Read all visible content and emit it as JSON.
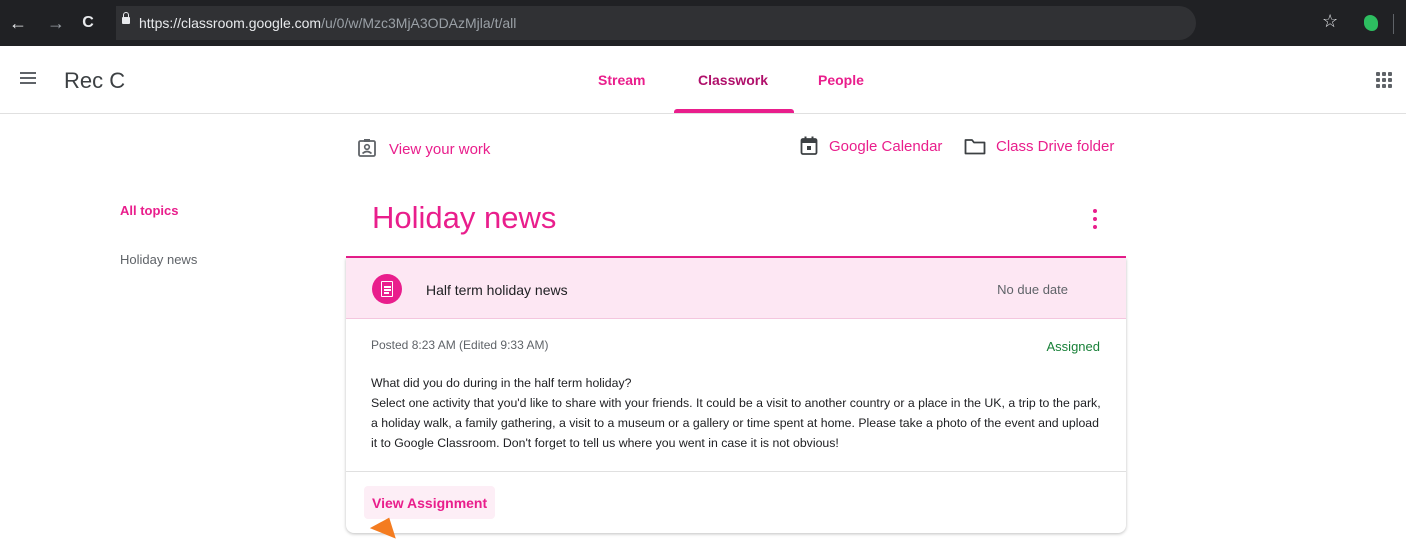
{
  "browser": {
    "url_host": "https://classroom.google.com",
    "url_path": "/u/0/w/Mzc3MjA3ODAzMjla/t/all",
    "back_glyph": "←",
    "forward_glyph": "→",
    "reload_glyph": "C",
    "star_glyph": "☆",
    "icons": [
      "back-icon",
      "forward-icon",
      "reload-icon",
      "lock-icon",
      "star-icon",
      "evernote-icon"
    ]
  },
  "header": {
    "class_name": "Rec C",
    "tabs": [
      {
        "label": "Stream",
        "active": false
      },
      {
        "label": "Classwork",
        "active": true
      },
      {
        "label": "People",
        "active": false
      }
    ]
  },
  "toolbar": {
    "view_work": "View your work",
    "calendar": "Google Calendar",
    "drive": "Class Drive folder"
  },
  "sidebar": {
    "items": [
      {
        "label": "All topics",
        "active": true
      },
      {
        "label": "Holiday news",
        "active": false
      }
    ]
  },
  "topic": {
    "title": "Holiday news",
    "assignment": {
      "title": "Half term holiday news",
      "due": "No due date",
      "posted": "Posted 8:23 AM (Edited 9:33 AM)",
      "status": "Assigned",
      "description": [
        "What did you do during in the half term holiday?",
        "Select one activity that you'd like to share with your friends. It could be a visit to another country or a place in the UK, a trip to the park, a holiday walk, a family gathering, a visit to a museum or a gallery or time spent at home. Please take a photo of the event and upload it to Google Classroom. Don't forget to tell us where you went in case it is not obvious!"
      ],
      "action": "View Assignment"
    }
  },
  "colors": {
    "accent": "#e91e8c",
    "accent_dark": "#b0106b",
    "card_header_bg": "#fde7f3",
    "status_green": "#188038",
    "annotation_arrow": "#f47c20"
  }
}
